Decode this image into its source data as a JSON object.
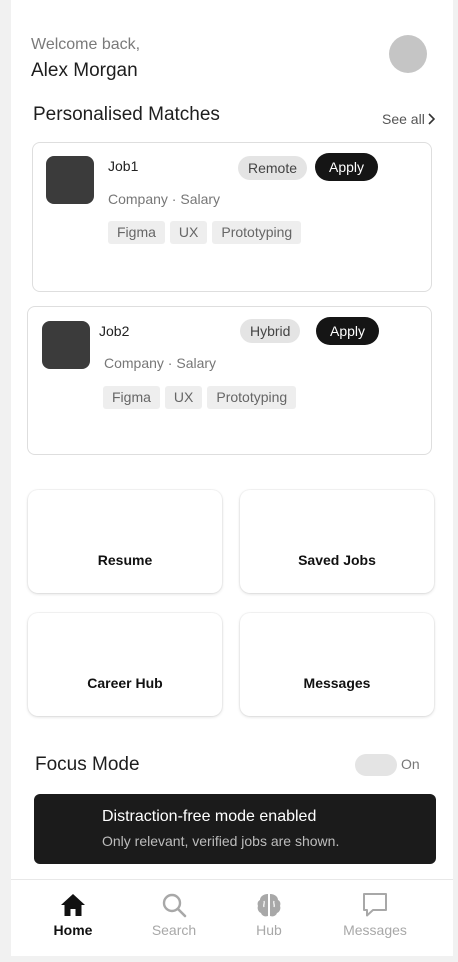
{
  "header": {
    "greeting": "Welcome back,",
    "user_name": "Alex Morgan"
  },
  "matches": {
    "title": "Personalised Matches",
    "see_all": "See all",
    "jobs": [
      {
        "title": "Job1",
        "meta": "Company · Salary",
        "work_mode": "Remote",
        "apply_label": "Apply",
        "tags": [
          "Figma",
          "UX",
          "Prototyping"
        ]
      },
      {
        "title": "Job2",
        "meta": "Company · Salary",
        "work_mode": "Hybrid",
        "apply_label": "Apply",
        "tags": [
          "Figma",
          "UX",
          "Prototyping"
        ]
      }
    ]
  },
  "tiles": [
    "Resume",
    "Saved Jobs",
    "Career Hub",
    "Messages"
  ],
  "focus": {
    "title": "Focus Mode",
    "toggle_label": "On",
    "banner_title": "Distraction-free mode enabled",
    "banner_subtitle": "Only relevant, verified jobs are shown."
  },
  "nav": {
    "items": [
      {
        "label": "Home",
        "icon": "home-icon",
        "active": true
      },
      {
        "label": "Search",
        "icon": "search-icon",
        "active": false
      },
      {
        "label": "Hub",
        "icon": "brain-icon",
        "active": false
      },
      {
        "label": "Messages",
        "icon": "chat-icon",
        "active": false
      }
    ]
  },
  "colors": {
    "dark": "#151515",
    "badge": "#e4e4e4",
    "tag": "#eeeeee",
    "avatar": "#c5c5c5",
    "inactive_nav": "#a8a8a8"
  }
}
